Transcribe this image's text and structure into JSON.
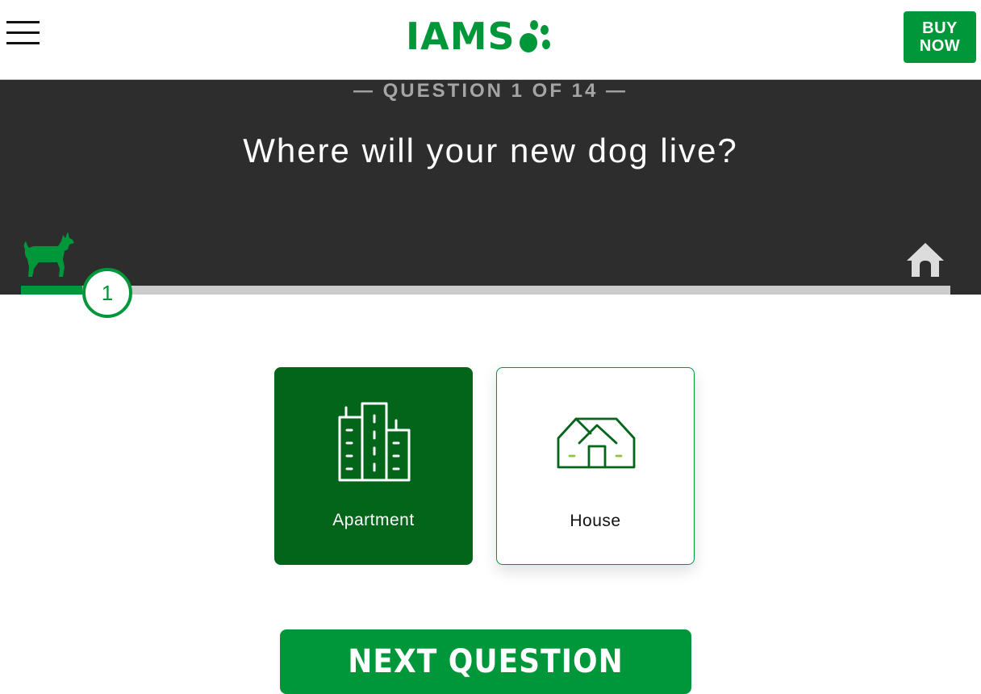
{
  "header": {
    "logo_text": "IAMS",
    "logo_icon": "paw-icon",
    "buy_button_label": "BUY\nNOW"
  },
  "quiz": {
    "counter": "— QUESTION 1 OF 14 —",
    "question": "Where will your new dog live?",
    "progress": {
      "current_step": "1",
      "total_steps": 14,
      "fraction": 0.066
    },
    "progress_start_icon": "dog-icon",
    "progress_end_icon": "home-icon"
  },
  "options": [
    {
      "label": "Apartment",
      "icon": "apartment-buildings-icon",
      "selected": true
    },
    {
      "label": "House",
      "icon": "house-icon",
      "selected": false
    }
  ],
  "next_button_label": "NEXT QUESTION",
  "colors": {
    "brand_green": "#00973a",
    "selected_green": "#036519",
    "banner_dark": "#2d2d2d",
    "track_gray": "#cccccc"
  }
}
